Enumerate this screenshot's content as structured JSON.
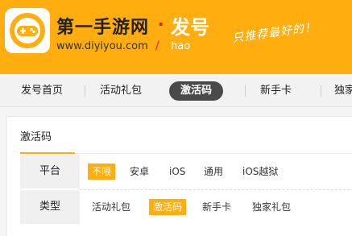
{
  "header": {
    "site_title": "第一手游网",
    "dot": "·",
    "section": "发号",
    "url": "www.diyiyou.com",
    "slash": "/",
    "sub": "hao",
    "slogan": "只推荐最好的！"
  },
  "nav": {
    "items": [
      {
        "label": "发号首页"
      },
      {
        "label": "活动礼包"
      },
      {
        "label": "激活码",
        "active": true
      },
      {
        "label": "新手卡"
      },
      {
        "label": "独家"
      }
    ]
  },
  "panel": {
    "title": "激活码",
    "filters": [
      {
        "label": "平台",
        "options": [
          "不限",
          "安卓",
          "iOS",
          "通用",
          "iOS越狱"
        ],
        "selected_index": 0
      },
      {
        "label": "类型",
        "options": [
          "活动礼包",
          "激活码",
          "新手卡",
          "独家礼包"
        ],
        "selected_index": 1
      }
    ]
  },
  "colors": {
    "brand_orange": "#ffad0f",
    "nav_active": "#4a4a4a",
    "accent_red": "#e02020"
  },
  "icons": {
    "logo": "gamepad-icon"
  }
}
